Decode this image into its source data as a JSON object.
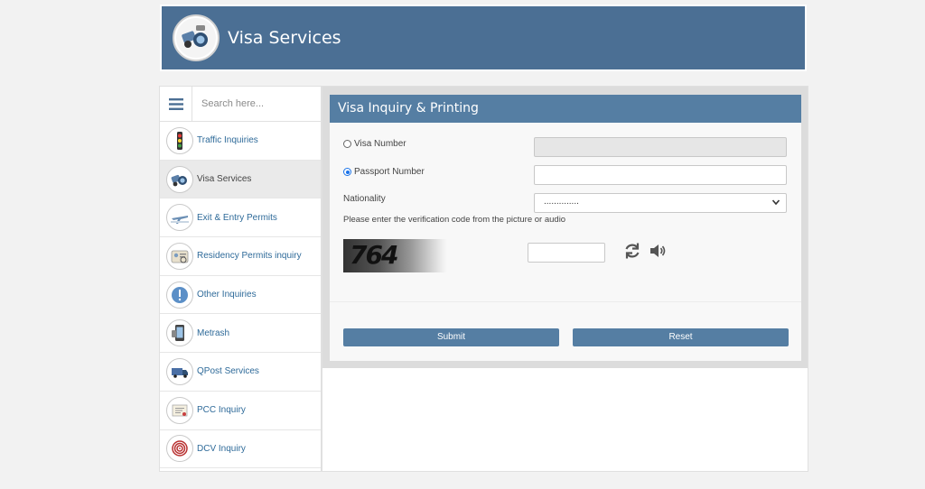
{
  "header": {
    "title": "Visa Services"
  },
  "search": {
    "placeholder": "Search here..."
  },
  "sidebar": {
    "items": [
      {
        "label": "Traffic Inquiries",
        "icon": "traffic-light-icon"
      },
      {
        "label": "Visa Services",
        "icon": "visa-services-icon",
        "active": true
      },
      {
        "label": "Exit & Entry Permits",
        "icon": "airplane-icon"
      },
      {
        "label": "Residency Permits inquiry",
        "icon": "id-card-icon"
      },
      {
        "label": "Other Inquiries",
        "icon": "info-exclamation-icon"
      },
      {
        "label": "Metrash",
        "icon": "mobile-phone-icon"
      },
      {
        "label": "QPost Services",
        "icon": "delivery-truck-icon"
      },
      {
        "label": "PCC Inquiry",
        "icon": "certificate-icon"
      },
      {
        "label": "DCV Inquiry",
        "icon": "fingerprint-icon"
      }
    ]
  },
  "panel": {
    "title": "Visa Inquiry & Printing",
    "visa_number_label": "Visa Number",
    "passport_number_label": "Passport Number",
    "nationality_label": "Nationality",
    "nationality_value": "..............",
    "instruction": "Please enter the verification code from the picture or audio",
    "captcha_code": "764",
    "submit_label": "Submit",
    "reset_label": "Reset",
    "selected_option": "Passport Number"
  },
  "colors": {
    "header_bg": "#4b6f94",
    "panel_header_bg": "#557ea3",
    "button_bg": "#557ea3",
    "link_text": "#2e6a99",
    "radio_checked": "#1a73e8"
  }
}
